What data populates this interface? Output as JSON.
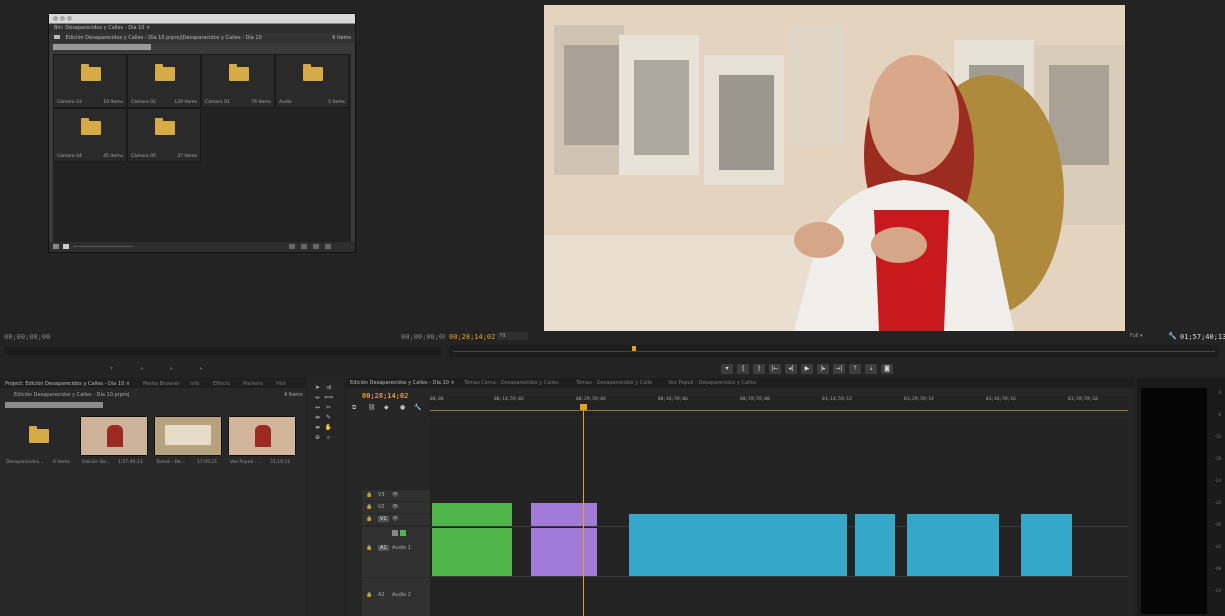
{
  "bin": {
    "tab": "Bin: Desaparecidos y Calles - Día 10 ×",
    "path": "Edición Desaparecidos y Calles - Día 10.prproj\\Desaparecidos y Calles - Día 10",
    "count": "6 Items",
    "items": [
      {
        "name": "Cámara 03",
        "count": "10 Items"
      },
      {
        "name": "Cámara 02",
        "count": "129 Items"
      },
      {
        "name": "Cámara 01",
        "count": "76 Items"
      },
      {
        "name": "Audio",
        "count": "5 Items"
      },
      {
        "name": "Cámara 04",
        "count": "45 Items"
      },
      {
        "name": "Cámara 05",
        "count": "37 Items"
      }
    ]
  },
  "source_monitor": {
    "tc_left": "00;00;00;00",
    "tc_right": "00;00;00;00"
  },
  "program_monitor": {
    "tc_current": "00;28;14;02",
    "fit": "Fit",
    "full": "Full",
    "tc_duration": "01;57;40;13"
  },
  "project": {
    "tabs": [
      "Project: Edición Desaparecidos y Calles - Día 10 ×",
      "Media Browser",
      "Info",
      "Effects",
      "Markers",
      "Hist"
    ],
    "file": "Edición Desaparecidos y Calles - Día 10.prproj",
    "count": "4 Items",
    "items": [
      {
        "name": "Desaparecidos...",
        "info": "6 Items"
      },
      {
        "name": "Edición De...",
        "info": "1;57;40;13"
      },
      {
        "name": "Tomas - De...",
        "info": "17;05;21"
      },
      {
        "name": "Vox Populi - ...",
        "info": "31;10;11"
      }
    ]
  },
  "timeline": {
    "tabs": [
      "Edición Desaparecidos y Calles - Día 10 ×",
      "Tomas Cerca - Desaparecidos y Calles",
      "Tomas - Desaparecidos y Calle",
      "Vox Populi - Desaparecidos y Calles"
    ],
    "timecode": "00;28;14;02",
    "ruler": [
      "00;00",
      "00;14;59;02",
      "00;29;59;04",
      "00;44;59;06",
      "00;59;59;08",
      "01;14;59;12",
      "01;29;59;14",
      "01;44;59;16",
      "01;59;59;18"
    ],
    "tracks": {
      "v3": "V3",
      "v2": "V2",
      "v1": "V1",
      "a1": "A1",
      "audio1": "Audio 1",
      "a2": "A2",
      "audio2": "Audio 2"
    },
    "playhead_fraction": 0.236
  },
  "meters": [
    "0",
    "-6",
    "-12",
    "-18",
    "-24",
    "-30",
    "-36",
    "-42",
    "-48",
    "-54"
  ],
  "colors": {
    "accent": "#e6a11c",
    "video_clip": "#4fb54b",
    "purple_clip": "#a27ad8",
    "cyan_clip": "#35a7c8"
  }
}
